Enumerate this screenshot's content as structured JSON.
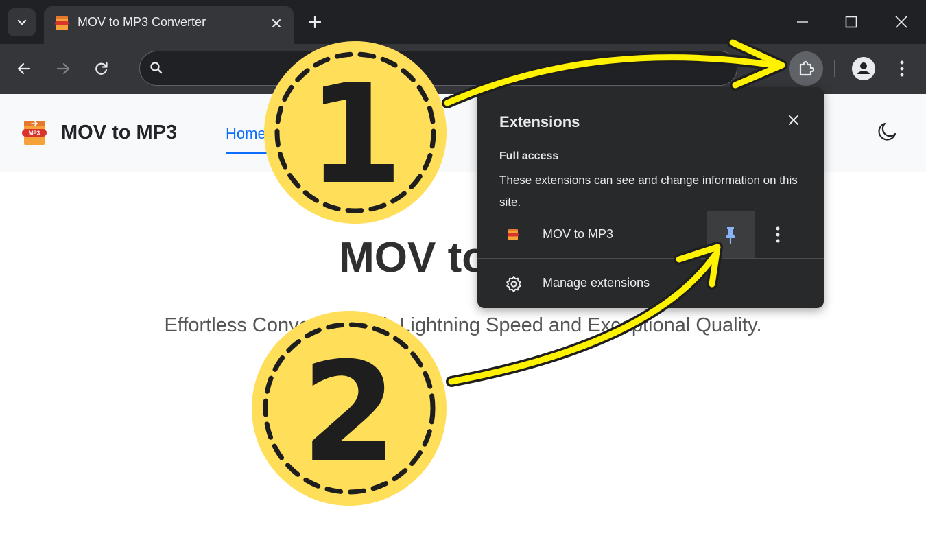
{
  "browser": {
    "tab": {
      "title": "MOV to MP3 Converter"
    },
    "omnibox": {
      "value": "",
      "placeholder": ""
    },
    "icons": [
      "tab-search-icon",
      "close-icon",
      "plus-icon",
      "minimize-icon",
      "maximize-icon",
      "close-window-icon",
      "back-arrow-icon",
      "forward-arrow-icon",
      "reload-icon",
      "search-icon",
      "puzzle-icon",
      "profile-icon",
      "kebab-menu-icon"
    ]
  },
  "site": {
    "name": "MOV to MP3",
    "nav": {
      "home_label": "Home"
    },
    "hero": {
      "title": "MOV to MP3",
      "subtitle": "Effortless Conversion with Lightning Speed and Exceptional Quality."
    },
    "icons": [
      "mp3-logo-icon",
      "moon-icon"
    ]
  },
  "extensions_popup": {
    "title": "Extensions",
    "section_heading": "Full access",
    "section_description": "These extensions can see and change information on this site.",
    "item": {
      "name": "MOV to MP3",
      "pinned": false
    },
    "manage_label": "Manage extensions",
    "icons": [
      "close-icon",
      "pin-icon",
      "kebab-menu-icon",
      "gear-icon"
    ]
  },
  "annotations": {
    "step1": "1",
    "step2": "2",
    "colors": {
      "badge_fill": "#FFDE59",
      "arrow": "#FFF200",
      "outline": "#1E1E1E"
    }
  },
  "colors": {
    "accent": "#0D6EFD",
    "chrome_dark": "#202124",
    "chrome_mid": "#35363A",
    "popup_bg": "#28292A",
    "pin_blue": "#8AB4F8"
  }
}
